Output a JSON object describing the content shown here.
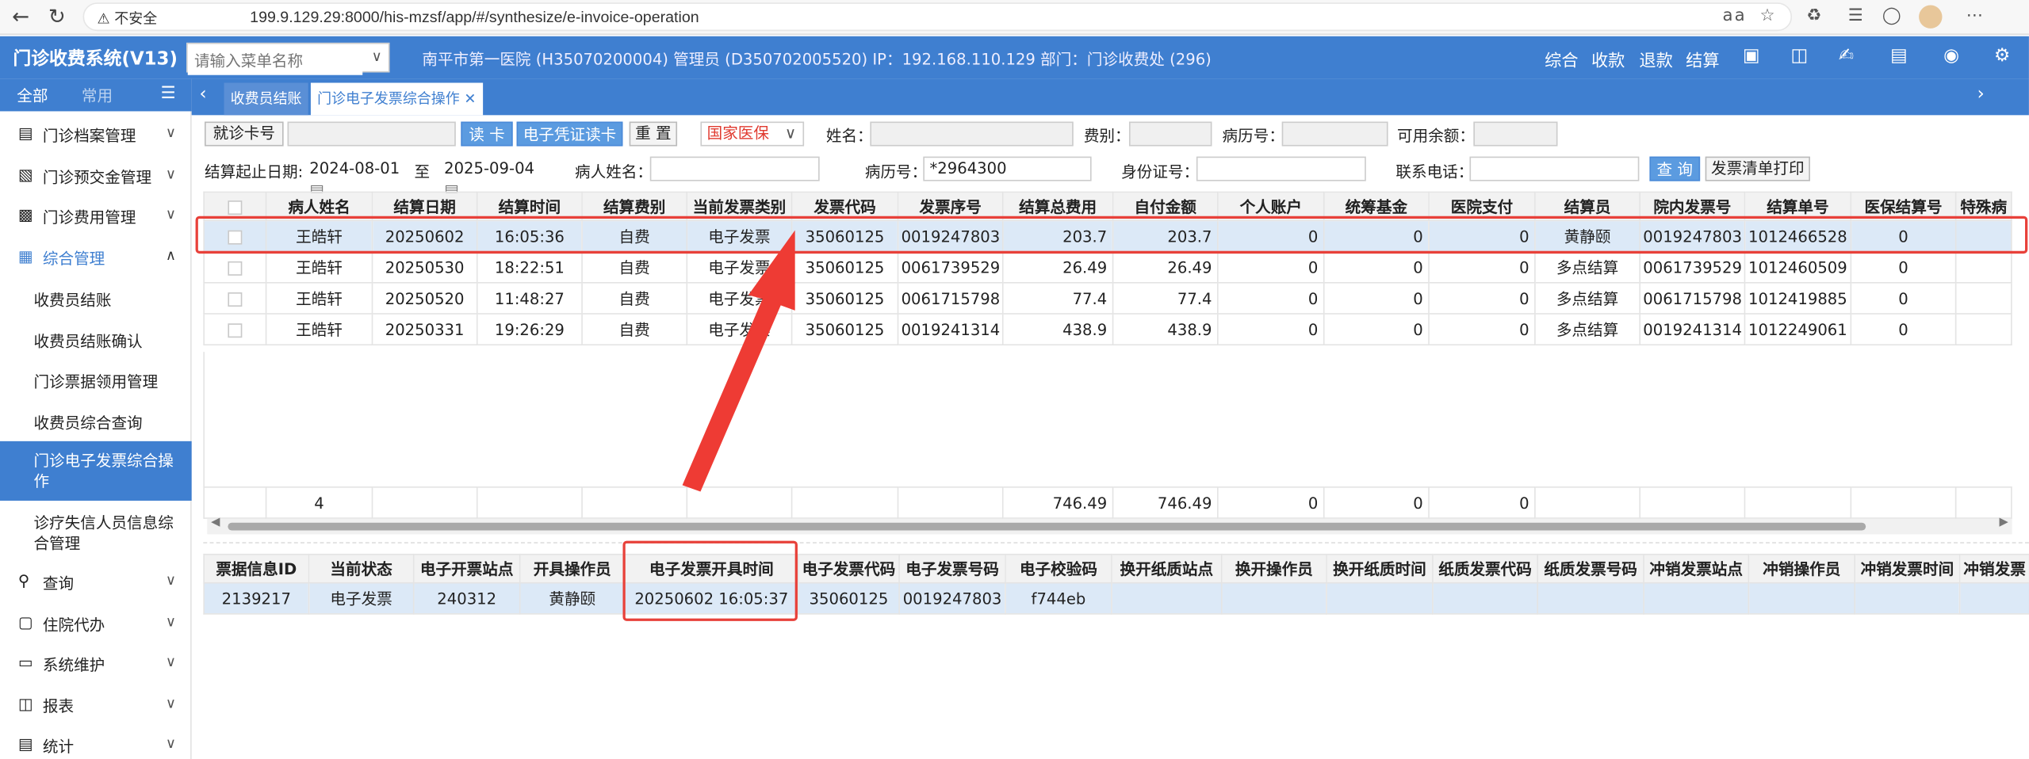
{
  "browser": {
    "insecure_label": "不安全",
    "url": "199.9.129.29:8000/his-mzsf/app/#/synthesize/e-invoice-operation"
  },
  "app": {
    "title": "门诊收费系统(V13)",
    "menu_search_placeholder": "请输入菜单名称",
    "header_info": "南平市第一医院 (H35070200004) 管理员 (D350702005520) IP：192.168.110.129 部门：门诊收费处 (296)",
    "header_actions": [
      "综合",
      "收款",
      "退款",
      "结算"
    ]
  },
  "sidebar": {
    "tab_all": "全部",
    "tab_common": "常用",
    "items": [
      {
        "label": "门诊档案管理",
        "icon": "folder-icon"
      },
      {
        "label": "门诊预交金管理",
        "icon": "wallet-icon"
      },
      {
        "label": "门诊费用管理",
        "icon": "bill-icon"
      },
      {
        "label": "综合管理",
        "icon": "grid-icon"
      }
    ],
    "sub_items": [
      "收费员结账",
      "收费员结账确认",
      "门诊票据领用管理",
      "收费员综合查询",
      "门诊电子发票综合操作",
      "诊疗失信人员信息综合管理"
    ],
    "bottom_items": [
      {
        "label": "查询",
        "icon": "search-icon"
      },
      {
        "label": "住院代办",
        "icon": "bed-icon"
      },
      {
        "label": "系统维护",
        "icon": "monitor-icon"
      },
      {
        "label": "报表",
        "icon": "report-icon"
      },
      {
        "label": "统计",
        "icon": "chart-icon"
      }
    ]
  },
  "tabs": [
    {
      "label": "收费员结账"
    },
    {
      "label": "门诊电子发票综合操作"
    }
  ],
  "search": {
    "card_label": "就诊卡号",
    "read_card": "读 卡",
    "e_voucher": "电子凭证读卡",
    "reset": "重 置",
    "insurance_select": "国家医保",
    "name_label": "姓名：",
    "fee_type_label": "费别：",
    "record_label": "病历号：",
    "balance_label": "可用余额：",
    "date_label": "结算起止日期:",
    "date_from": "2024-08-01",
    "date_to_sep": "至",
    "date_to": "2025-09-04",
    "patient_name_label": "病人姓名：",
    "record_no_label": "病历号：",
    "record_no_value": "*2964300",
    "id_label": "身份证号：",
    "phone_label": "联系电话：",
    "query": "查 询",
    "print_list": "发票清单打印"
  },
  "table1": {
    "columns": [
      "",
      "病人姓名",
      "结算日期",
      "结算时间",
      "结算费别",
      "当前发票类别",
      "发票代码",
      "发票序号",
      "结算总费用",
      "自付金额",
      "个人账户",
      "统筹基金",
      "医院支付",
      "结算员",
      "院内发票号",
      "结算单号",
      "医保结算号",
      "特殊病"
    ],
    "rows": [
      [
        "",
        "王皓轩",
        "20250602",
        "16:05:36",
        "自费",
        "电子发票",
        "35060125",
        "0019247803",
        "203.7",
        "203.7",
        "0",
        "0",
        "0",
        "黄静颐",
        "0019247803",
        "1012466528",
        "0",
        ""
      ],
      [
        "",
        "王皓轩",
        "20250530",
        "18:22:51",
        "自费",
        "电子发票",
        "35060125",
        "0061739529",
        "26.49",
        "26.49",
        "0",
        "0",
        "0",
        "多点结算",
        "0061739529",
        "1012460509",
        "0",
        ""
      ],
      [
        "",
        "王皓轩",
        "20250520",
        "11:48:27",
        "自费",
        "电子发票",
        "35060125",
        "0061715798",
        "77.4",
        "77.4",
        "0",
        "0",
        "0",
        "多点结算",
        "0061715798",
        "1012419885",
        "0",
        ""
      ],
      [
        "",
        "王皓轩",
        "20250331",
        "19:26:29",
        "自费",
        "电子发票",
        "35060125",
        "0019241314",
        "438.9",
        "438.9",
        "0",
        "0",
        "0",
        "多点结算",
        "0019241314",
        "1012249061",
        "0",
        ""
      ]
    ],
    "totals": [
      "",
      "4",
      "",
      "",
      "",
      "",
      "",
      "",
      "746.49",
      "746.49",
      "0",
      "0",
      "0",
      "",
      "",
      "",
      "",
      ""
    ]
  },
  "table2": {
    "columns": [
      "票据信息ID",
      "当前状态",
      "电子开票站点",
      "开具操作员",
      "电子发票开具时间",
      "电子发票代码",
      "电子发票号码",
      "电子校验码",
      "换开纸质站点",
      "换开操作员",
      "换开纸质时间",
      "纸质发票代码",
      "纸质发票号码",
      "冲销发票站点",
      "冲销操作员",
      "冲销发票时间",
      "冲销发票"
    ],
    "rows": [
      [
        "2139217",
        "电子发票",
        "240312",
        "黄静颐",
        "20250602 16:05:37",
        "35060125",
        "0019247803",
        "f744eb",
        "",
        "",
        "",
        "",
        "",
        "",
        "",
        "",
        ""
      ]
    ]
  },
  "colors": {
    "primary": "#3f7fd0",
    "highlight": "#e8413a",
    "selected_row": "#dce9f7"
  }
}
